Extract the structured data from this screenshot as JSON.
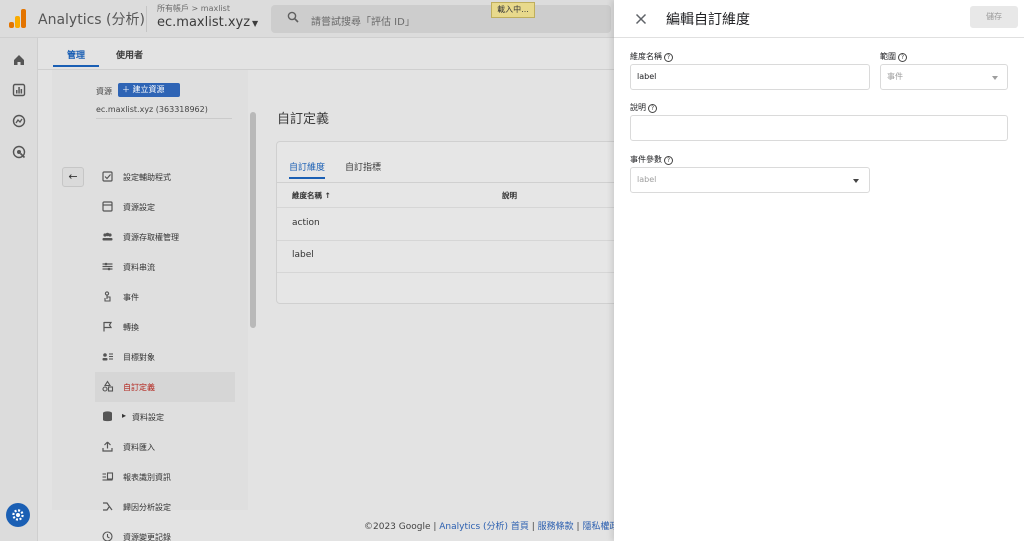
{
  "app": {
    "name": "Analytics (分析)",
    "breadcrumb": "所有帳戶 > maxlist",
    "property_name": "ec.maxlist.xyz",
    "search_placeholder": "請嘗試搜尋「評估 ID」",
    "loading_badge": "載入中..."
  },
  "top_tabs": {
    "admin": "管理",
    "user": "使用者"
  },
  "admin_panel": {
    "resource_label": "資源",
    "create_button": "建立資源",
    "resource_name": "ec.maxlist.xyz (363318962)",
    "items": [
      {
        "label": "設定輔助程式",
        "icon": "checklist-icon"
      },
      {
        "label": "資源設定",
        "icon": "property-settings-icon"
      },
      {
        "label": "資源存取權管理",
        "icon": "people-icon"
      },
      {
        "label": "資料串流",
        "icon": "data-stream-icon"
      },
      {
        "label": "事件",
        "icon": "touch-icon"
      },
      {
        "label": "轉換",
        "icon": "flag-icon"
      },
      {
        "label": "目標對象",
        "icon": "audience-icon"
      },
      {
        "label": "自訂定義",
        "icon": "shapes-icon"
      },
      {
        "label": "資料設定",
        "icon": "database-icon"
      },
      {
        "label": "資料匯入",
        "icon": "upload-icon"
      },
      {
        "label": "報表識別資訊",
        "icon": "identity-icon"
      },
      {
        "label": "歸因分析設定",
        "icon": "attribution-icon"
      },
      {
        "label": "資源變更記錄",
        "icon": "history-icon"
      }
    ],
    "active_index": 7
  },
  "custom_definitions": {
    "title": "自訂定義",
    "tabs": [
      "自訂維度",
      "自訂指標"
    ],
    "columns": [
      "維度名稱",
      "說明"
    ],
    "rows": [
      "action",
      "label"
    ]
  },
  "footer": {
    "copyright": "©2023 Google | ",
    "home": "Analytics (分析) 首頁",
    "sep1": " | ",
    "terms": "服務條款",
    "sep2": " | ",
    "privacy": "隱私權政策"
  },
  "edit_panel": {
    "title": "編輯自訂維度",
    "save_label": "儲存",
    "dimension_name_label": "維度名稱",
    "dimension_name_value": "label",
    "scope_label": "範圍",
    "scope_value": "事件",
    "description_label": "說明",
    "description_value": "",
    "event_param_label": "事件參數",
    "event_param_value": "label"
  },
  "colors": {
    "accent": "#1a5fb4",
    "active_menu_text": "#b3261e",
    "logo_orange": "#f9ab00",
    "logo_dark": "#e37400"
  }
}
